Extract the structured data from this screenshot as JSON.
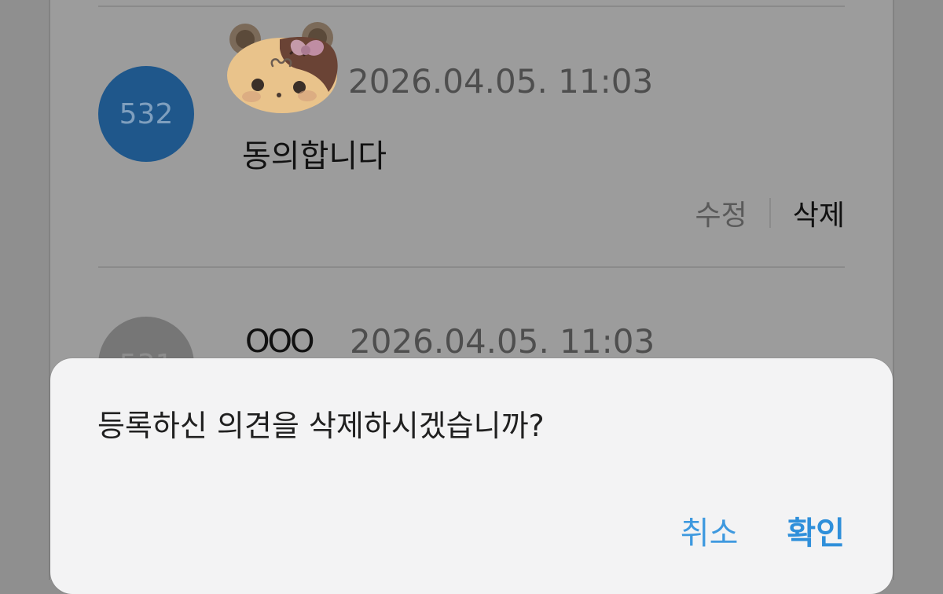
{
  "comments": [
    {
      "number": "532",
      "timestamp": "2026.04.05. 11:03",
      "text": "동의합니다",
      "actions": {
        "edit_label": "수정",
        "delete_label": "삭제"
      }
    },
    {
      "number": "531",
      "author": "OOO",
      "timestamp": "2026.04.05. 11:03"
    }
  ],
  "dialog": {
    "message": "등록하신 의견을 삭제하시겠습니까?",
    "cancel_label": "취소",
    "confirm_label": "확인"
  },
  "colors": {
    "number_circle_active": "#1f578b",
    "dialog_button": "#2f8fda",
    "overlay": "#8f8f8f"
  },
  "icons": {
    "avatar": "bear-avatar-icon"
  }
}
